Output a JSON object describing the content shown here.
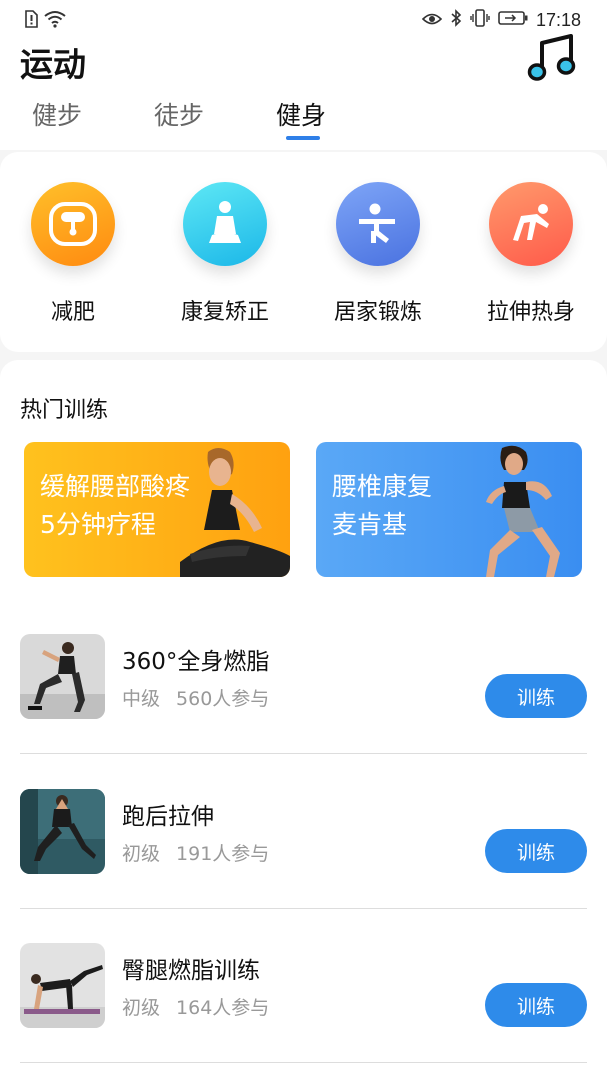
{
  "status_bar": {
    "time": "17:18"
  },
  "header": {
    "title": "运动"
  },
  "tabs": [
    {
      "label": "健步"
    },
    {
      "label": "徒步"
    },
    {
      "label": "健身"
    }
  ],
  "categories": [
    {
      "label": "减肥",
      "icon": "scale-icon",
      "color_from": "#ffc02a",
      "color_to": "#ff8a10"
    },
    {
      "label": "康复矫正",
      "icon": "person-sitting-icon",
      "color_from": "#5ee8f5",
      "color_to": "#1bb7e8"
    },
    {
      "label": "居家锻炼",
      "icon": "person-stretch-icon",
      "color_from": "#7ea5f7",
      "color_to": "#4a72e0"
    },
    {
      "label": "拉伸热身",
      "icon": "person-yoga-icon",
      "color_from": "#ff9a6c",
      "color_to": "#ff5a4a"
    }
  ],
  "hot_training": {
    "title": "热门训练",
    "banners": [
      {
        "line1": "缓解腰部酸疼",
        "line2": "5分钟疗程",
        "color_from": "#ffc21e",
        "color_to": "#ff9f0f"
      },
      {
        "line1": "腰椎康复",
        "line2": "麦肯基",
        "color_from": "#54a3f5",
        "color_to": "#2f86f0"
      }
    ]
  },
  "courses": [
    {
      "title": "360°全身燃脂",
      "level": "中级",
      "participants": "560人参与",
      "button": "训练"
    },
    {
      "title": "跑后拉伸",
      "level": "初级",
      "participants": "191人参与",
      "button": "训练"
    },
    {
      "title": "臀腿燃脂训练",
      "level": "初级",
      "participants": "164人参与",
      "button": "训练"
    }
  ],
  "colors": {
    "accent": "#2e8bea",
    "tab_indicator": "#2e7fe8"
  }
}
